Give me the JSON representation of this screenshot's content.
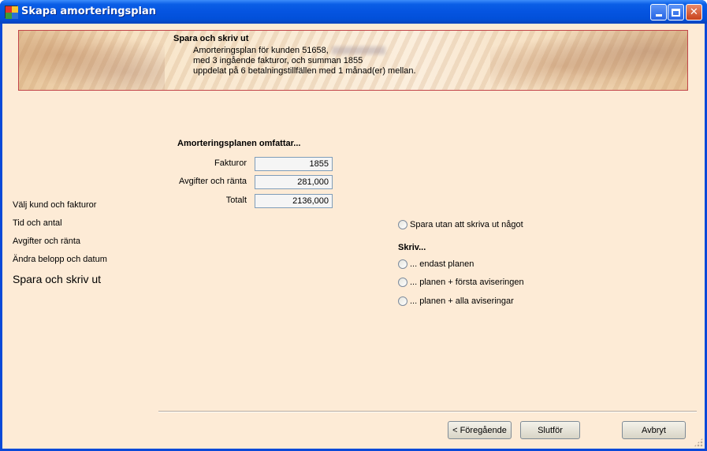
{
  "window": {
    "title": "Skapa amorteringsplan"
  },
  "banner": {
    "title": "Spara och skriv ut",
    "line1": "Amorteringsplan för kunden 51658,",
    "line2": "med 3 ingående fakturor, och summan 1855",
    "line3": "uppdelat på 6 betalningstillfällen med 1 månad(er) mellan."
  },
  "summary": {
    "heading": "Amorteringsplanen omfattar...",
    "rows": [
      {
        "label": "Fakturor",
        "value": "1855"
      },
      {
        "label": "Avgifter och ränta",
        "value": "281,000"
      },
      {
        "label": "Totalt",
        "value": "2136,000"
      }
    ]
  },
  "steps": [
    {
      "label": "Välj kund och fakturor",
      "active": false
    },
    {
      "label": "Tid och antal",
      "active": false
    },
    {
      "label": "Avgifter och ränta",
      "active": false
    },
    {
      "label": "Ändra belopp och datum",
      "active": false
    },
    {
      "label": "Spara och skriv ut",
      "active": true
    }
  ],
  "options": {
    "save_only": "Spara utan att skriva ut något",
    "write_heading": "Skriv...",
    "plan_only": "... endast planen",
    "plan_first": "... planen + första aviseringen",
    "plan_all": "... planen + alla aviseringar"
  },
  "buttons": {
    "previous": "< Föregående",
    "finish": "Slutför",
    "cancel": "Avbryt"
  }
}
